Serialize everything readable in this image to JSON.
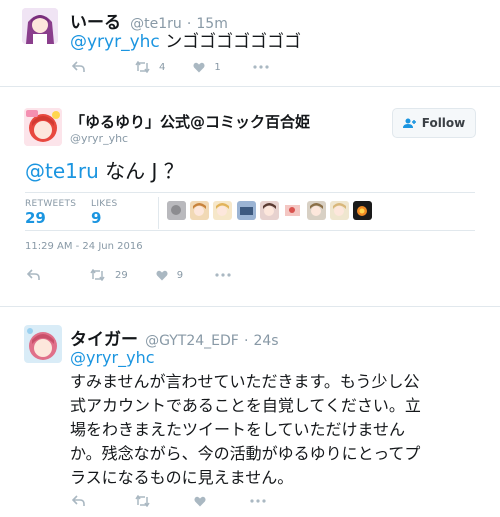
{
  "tweet1": {
    "display_name": "いーる",
    "handle": "@te1ru",
    "separator": "·",
    "time": "15m",
    "reply_to": "@yryr_yhc",
    "text": "ンゴゴゴゴゴゴゴ",
    "retweet_count": "4",
    "like_count": "1"
  },
  "tweet2": {
    "display_name": "「ゆるゆり」公式@コミック百合姫",
    "handle": "@yryr_yhc",
    "follow_label": "Follow",
    "mention": "@te1ru",
    "text": " なん J ？",
    "retweets_label": "RETWEETS",
    "retweets_value": "29",
    "likes_label": "LIKES",
    "likes_value": "9",
    "timestamp": "11:29 AM - 24 Jun 2016",
    "retweet_count": "29",
    "like_count": "9"
  },
  "tweet3": {
    "display_name": "タイガー",
    "handle": "@GYT24_EDF",
    "separator": "·",
    "time": "24s",
    "reply_to": "@yryr_yhc",
    "lines": [
      "すみませんが言わせていただきます。もう少し公",
      "式アカウントであることを自覚してください。立",
      "場をわきまえたツイートをしていただけません",
      "か。残念ながら、今の活動がゆるゆりにとってプ",
      "ラスになるものに見えません。"
    ]
  },
  "icons": [
    "reply-icon",
    "retweet-icon",
    "like-icon",
    "more-icon",
    "follow-person-icon"
  ],
  "colors": {
    "link": "#1b95e0",
    "muted": "#8899a6",
    "icon": "#aab8c2",
    "divider": "#e1e8ed"
  }
}
